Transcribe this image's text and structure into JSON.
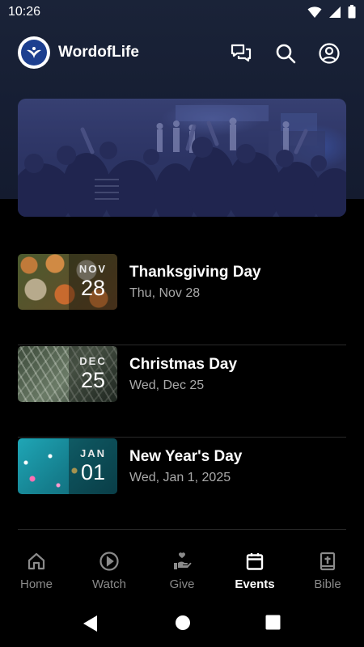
{
  "status_bar": {
    "time": "10:26"
  },
  "app": {
    "title": "WordofLife"
  },
  "header_icons": [
    "chat-icon",
    "search-icon",
    "account-icon"
  ],
  "events": [
    {
      "title": "Thanksgiving Day",
      "date": "Thu, Nov 28",
      "month": "NOV",
      "day": "28"
    },
    {
      "title": "Christmas Day",
      "date": "Wed, Dec 25",
      "month": "DEC",
      "day": "25"
    },
    {
      "title": "New Year's Day",
      "date": "Wed, Jan 1, 2025",
      "month": "JAN",
      "day": "01"
    }
  ],
  "bottom_nav": [
    {
      "label": "Home",
      "icon": "home-icon",
      "active": false
    },
    {
      "label": "Watch",
      "icon": "play-circle-icon",
      "active": false
    },
    {
      "label": "Give",
      "icon": "give-hand-icon",
      "active": false
    },
    {
      "label": "Events",
      "icon": "calendar-icon",
      "active": true
    },
    {
      "label": "Bible",
      "icon": "bible-icon",
      "active": false
    }
  ],
  "colors": {
    "background": "#000000",
    "header": "#161e33",
    "inactive": "#8a8a8a",
    "active": "#ffffff"
  }
}
